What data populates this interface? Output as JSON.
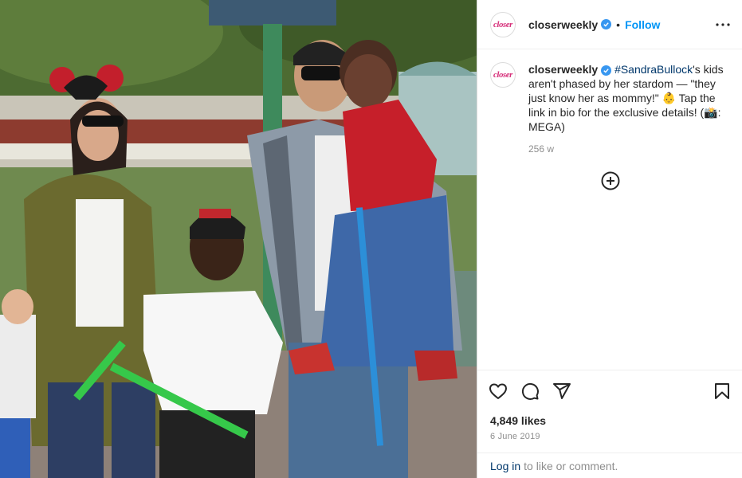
{
  "post": {
    "photo": "family-outing-photo",
    "account": {
      "username": "closerweekly",
      "avatar_text": "closer",
      "verified": true,
      "follow_label": "Follow",
      "separator": "•"
    },
    "caption": {
      "username": "closerweekly",
      "hashtag": "#SandraBullock",
      "text_before": "'s kids aren't phased by her stardom — \"they just know her as mommy!\" 👶 Tap the link in bio for the exclusive details! (📸: MEGA)",
      "time": "256 w"
    },
    "likes": "4,849 likes",
    "date": "6 June 2019",
    "comment_prompt": {
      "login_label": "Log in",
      "rest": "to like or comment."
    },
    "icons": {
      "more": "more-options-icon",
      "load_more": "add-circle-icon",
      "like": "heart-icon",
      "comment": "comment-icon",
      "share": "send-icon",
      "save": "bookmark-icon"
    },
    "colors": {
      "follow_blue": "#0095f6",
      "link_navy": "#00376b",
      "muted_gray": "#8e8e8e",
      "verified_blue": "#3897f0"
    }
  }
}
